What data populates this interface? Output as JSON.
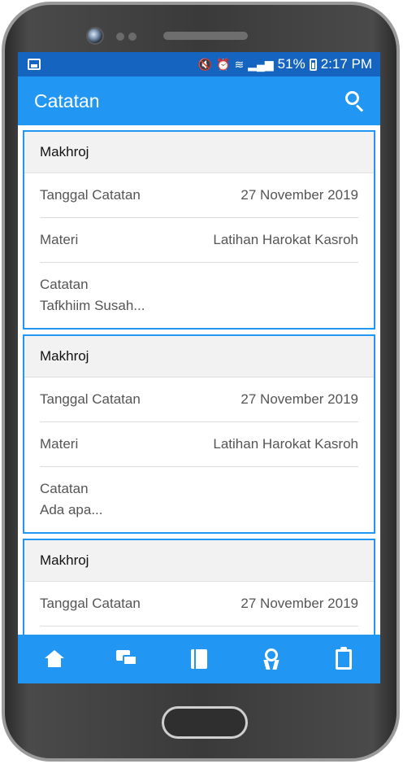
{
  "status_bar": {
    "battery": "51%",
    "time": "2:17 PM",
    "icons": [
      "image-icon",
      "mute-vibrate-icon",
      "alarm-icon",
      "wifi-icon",
      "signal-icon",
      "battery-icon"
    ]
  },
  "app_bar": {
    "title": "Catatan",
    "search_icon": "search-icon"
  },
  "notes": [
    {
      "header": "Makhroj",
      "date_label": "Tanggal Catatan",
      "date_value": "27 November 2019",
      "materi_label": "Materi",
      "materi_value": "Latihan Harokat Kasroh",
      "catatan_label": "Catatan",
      "catatan_value": "Tafkhiim Susah..."
    },
    {
      "header": "Makhroj",
      "date_label": "Tanggal Catatan",
      "date_value": "27 November 2019",
      "materi_label": "Materi",
      "materi_value": "Latihan Harokat Kasroh",
      "catatan_label": "Catatan",
      "catatan_value": "Ada apa..."
    },
    {
      "header": "Makhroj",
      "date_label": "Tanggal Catatan",
      "date_value": "27 November 2019"
    }
  ],
  "bottom_nav": [
    "home-icon",
    "chat-icon",
    "book-icon",
    "award-icon",
    "clipboard-icon"
  ],
  "colors": {
    "primary": "#2196f3",
    "status_bar": "#1565c0",
    "card_header_bg": "#f2f2f2"
  }
}
